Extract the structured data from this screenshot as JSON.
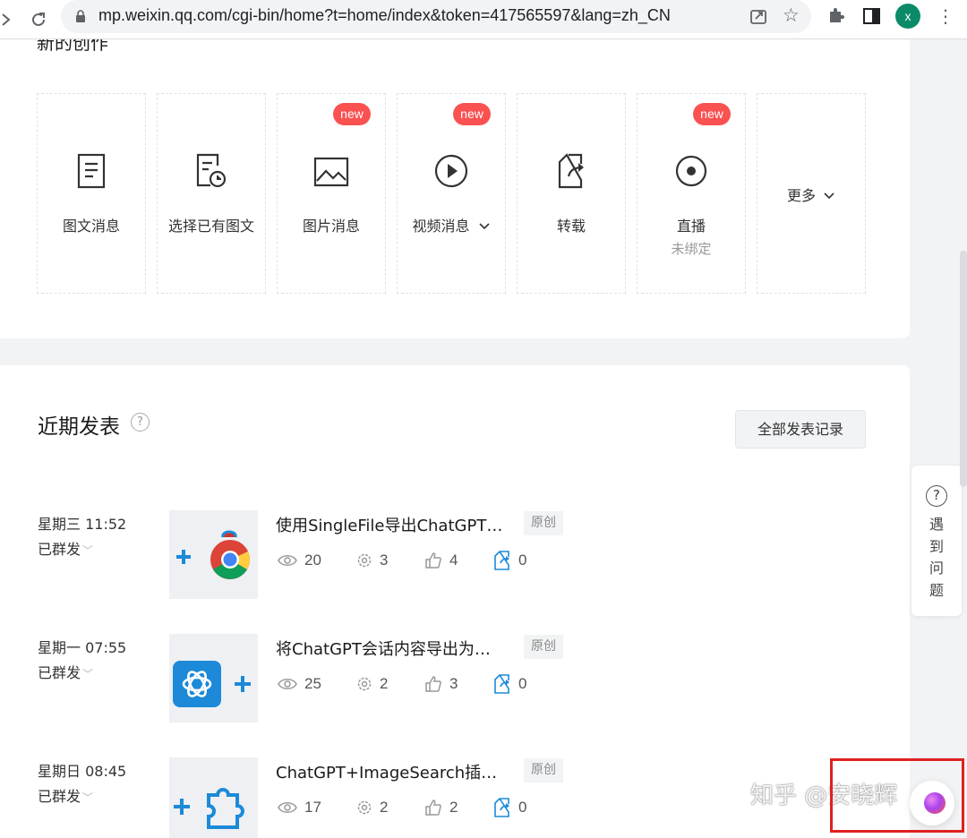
{
  "browser": {
    "url": "mp.weixin.qq.com/cgi-bin/home?t=home/index&token=417565597&lang=zh_CN",
    "profile_initial": "x"
  },
  "create": {
    "partial_title": "新的创作",
    "tiles": [
      {
        "label": "图文消息",
        "icon": "article-icon",
        "badge": ""
      },
      {
        "label": "选择已有图文",
        "icon": "article-history-icon",
        "badge": ""
      },
      {
        "label": "图片消息",
        "icon": "image-icon",
        "badge": "new"
      },
      {
        "label": "视频消息",
        "icon": "video-play-icon",
        "badge": "new",
        "dropdown": true
      },
      {
        "label": "转载",
        "icon": "repost-icon",
        "badge": ""
      },
      {
        "label": "直播",
        "sub": "未绑定",
        "icon": "live-icon",
        "badge": "new"
      },
      {
        "label": "更多",
        "icon": "chevron-down-icon",
        "dropdown": true
      }
    ]
  },
  "recent": {
    "title": "近期发表",
    "all_records_label": "全部发表记录",
    "posts": [
      {
        "time": "星期三 11:52",
        "status": "已群发",
        "title": "使用SingleFile导出ChatGPT…",
        "tag": "原创",
        "views": "20",
        "shares": "3",
        "likes": "4",
        "reposts": "0"
      },
      {
        "time": "星期一 07:55",
        "status": "已群发",
        "title": "将ChatGPT会话内容导出为…",
        "tag": "原创",
        "views": "25",
        "shares": "2",
        "likes": "3",
        "reposts": "0"
      },
      {
        "time": "星期日 08:45",
        "status": "已群发",
        "title": "ChatGPT+ImageSearch插…",
        "tag": "原创",
        "views": "17",
        "shares": "2",
        "likes": "2",
        "reposts": "0"
      }
    ]
  },
  "side_help": {
    "icon": "?",
    "label": "遇到问题"
  },
  "watermark": "知乎 @安晓辉",
  "colors": {
    "badge": "#fa5151",
    "accent_blue": "#1c8ad8",
    "annotation_box": "#e02020"
  }
}
